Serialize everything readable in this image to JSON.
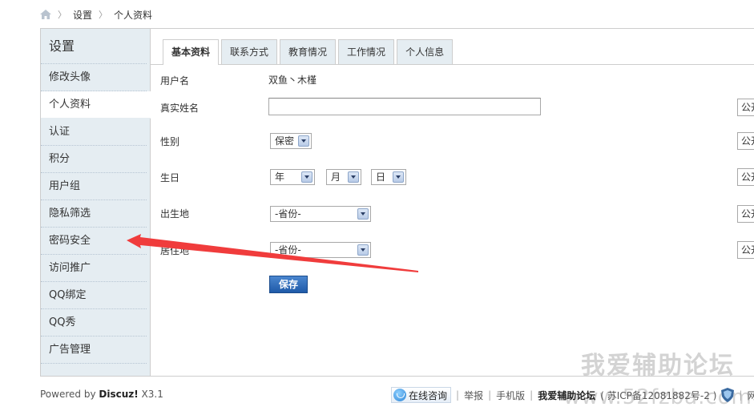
{
  "breadcrumb": {
    "items": [
      "设置",
      "个人资料"
    ]
  },
  "sidebar": {
    "title": "设置",
    "items": [
      {
        "label": "修改头像"
      },
      {
        "label": "个人资料",
        "active": true
      },
      {
        "label": "认证"
      },
      {
        "label": "积分"
      },
      {
        "label": "用户组"
      },
      {
        "label": "隐私筛选"
      },
      {
        "label": "密码安全"
      },
      {
        "label": "访问推广"
      },
      {
        "label": "QQ绑定"
      },
      {
        "label": "QQ秀"
      },
      {
        "label": "广告管理"
      }
    ]
  },
  "tabs": [
    {
      "label": "基本资料",
      "active": true
    },
    {
      "label": "联系方式"
    },
    {
      "label": "教育情况"
    },
    {
      "label": "工作情况"
    },
    {
      "label": "个人信息"
    }
  ],
  "form": {
    "username_label": "用户名",
    "username_value": "双鱼丶木槿",
    "realname_label": "真实姓名",
    "realname_value": "",
    "gender_label": "性别",
    "gender_value": "保密",
    "birthday_label": "生日",
    "birth_year": "年",
    "birth_month": "月",
    "birth_day": "日",
    "birthplace_label": "出生地",
    "birthplace_value": "-省份-",
    "residence_label": "居住地",
    "residence_value": "-省份-",
    "privacy_value": "公开",
    "save_label": "保存"
  },
  "watermark": {
    "line1": "我爱辅助论坛",
    "line2": "www.52fzba.com"
  },
  "footer": {
    "powered_prefix": "Powered by ",
    "powered_brand": "Discuz!",
    "powered_version": " X3.1",
    "online_label": "在线咨询",
    "report": "举报",
    "mobile": "手机版",
    "site_name": "我爱辅助论坛",
    "icp": "( 苏ICP备12081882号-2 )",
    "trailing": "网"
  },
  "colors": {
    "sidebar_bg": "#e5edf2",
    "border": "#cdcdcd",
    "save_button": "#2a66b4",
    "annotation_arrow": "#f03c3c"
  }
}
